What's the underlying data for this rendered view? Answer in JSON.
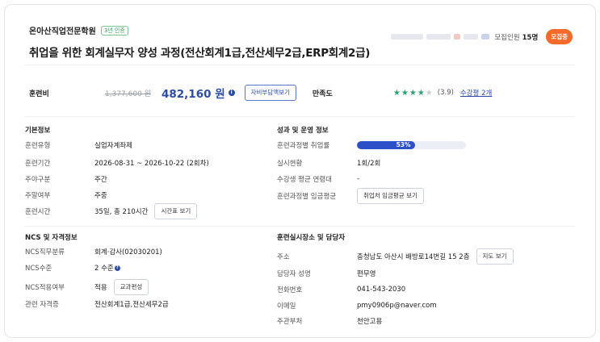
{
  "header": {
    "institution": "온아산직업전문학원",
    "cert_badge": "3년 인증",
    "course_title": "취업을 위한 회계실무자 양성 과정(전산회계1급,전산세무2급,ERP회계2급)",
    "quota_label": "모집인원",
    "quota_value": "15명",
    "status_badge": "모집중"
  },
  "fee": {
    "label": "훈련비",
    "original": "1,377,600 원",
    "current": "482,160 원",
    "info_icon": "info-icon",
    "self_pay_button": "자비부담액보기"
  },
  "satisfaction": {
    "label": "만족도",
    "rating": 3.9,
    "max": 5,
    "score_text": "(3.9)",
    "review_link": "수강평 2개"
  },
  "basic_info": {
    "title": "기본정보",
    "rows": [
      {
        "k": "훈련유형",
        "v": "실업자계좌제"
      },
      {
        "k": "훈련기간",
        "v": "2026-08-31 ~ 2026-10-22 (2회차)"
      },
      {
        "k": "주야구분",
        "v": "주간"
      },
      {
        "k": "주말여부",
        "v": "주중"
      },
      {
        "k": "훈련시간",
        "v": "35일, 총 210시간"
      }
    ],
    "timetable_button": "시간표 보기"
  },
  "performance": {
    "title": "성과 및 운영 정보",
    "employment_label": "훈련과정별 취업률",
    "employment_rate": 53,
    "employment_text": "53%",
    "rows": [
      {
        "k": "실시현황",
        "v": "1회/2회"
      },
      {
        "k": "수강생 평균 연령대",
        "v": "-"
      },
      {
        "k": "훈련과정별 임금평균",
        "v": ""
      }
    ],
    "wage_button": "취업처 임금평균 보기"
  },
  "ncs": {
    "title": "NCS 및 자격정보",
    "rows": [
      {
        "k": "NCS직무분류",
        "v": "회계·감사(02030201)"
      },
      {
        "k": "NCS수준",
        "v": "2 수준"
      },
      {
        "k": "NCS적용여부",
        "v": "적용"
      },
      {
        "k": "관련 자격증",
        "v": "전산회계1급,전산세무2급"
      }
    ],
    "curriculum_button": "교과편성"
  },
  "location": {
    "title": "훈련실시장소 및 담당자",
    "rows": [
      {
        "k": "주소",
        "v": "충청남도 아산시 배방로14번길 15 2층"
      },
      {
        "k": "담당자 성명",
        "v": "편무영"
      },
      {
        "k": "전화번호",
        "v": "041-543-2030"
      },
      {
        "k": "이메일",
        "v": "pmy0906p@naver.com"
      },
      {
        "k": "주관부처",
        "v": "천안고용"
      }
    ],
    "map_button": "지도 보기"
  },
  "colors": {
    "accent": "#2d4ca8",
    "badge_orange": "#f26b2b",
    "star_green": "#2fa06f",
    "progress_blue": "#2d50c8"
  }
}
